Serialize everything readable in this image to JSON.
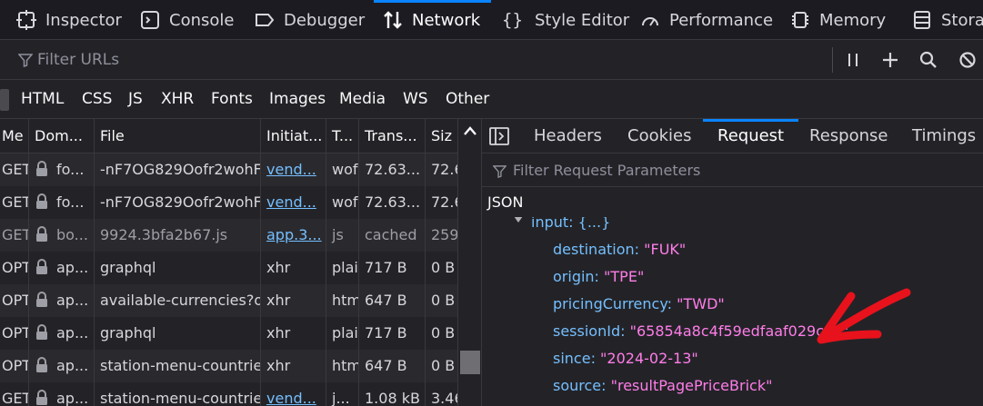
{
  "toolbar": {
    "tabs": [
      {
        "label": "Inspector",
        "icon": "inspector-icon"
      },
      {
        "label": "Console",
        "icon": "console-icon"
      },
      {
        "label": "Debugger",
        "icon": "debugger-icon"
      },
      {
        "label": "Network",
        "icon": "network-icon",
        "active": true
      },
      {
        "label": "Style Editor",
        "icon": "braces-icon"
      },
      {
        "label": "Performance",
        "icon": "gauge-icon"
      },
      {
        "label": "Memory",
        "icon": "chip-icon"
      },
      {
        "label": "Storag",
        "icon": "storage-icon"
      }
    ]
  },
  "filter": {
    "placeholder": "Filter URLs"
  },
  "type_filters": [
    "HTML",
    "CSS",
    "JS",
    "XHR",
    "Fonts",
    "Images",
    "Media",
    "WS",
    "Other"
  ],
  "table": {
    "headers": [
      "Me",
      "Dom...",
      "File",
      "Initiat...",
      "T...",
      "Trans...",
      "Siz"
    ],
    "rows": [
      {
        "method": "GET",
        "domain": "fo...",
        "file": "-nF7OG829Oofr2wohF",
        "initiator": "vend...",
        "type": "wof",
        "transferred": "72.63...",
        "size": "72.6"
      },
      {
        "method": "GET",
        "domain": "fo...",
        "file": "-nF7OG829Oofr2wohF",
        "initiator": "vend...",
        "type": "wof",
        "transferred": "72.63...",
        "size": "72.6"
      },
      {
        "method": "GET",
        "domain": "bo...",
        "file": "9924.3bfa2b67.js",
        "initiator": "app.3...",
        "type": "js",
        "transferred": "cached",
        "size": "259"
      },
      {
        "method": "OPT",
        "domain": "ap...",
        "file": "graphql",
        "initiator": "xhr",
        "type": "plai",
        "transferred": "717 B",
        "size": "0 B"
      },
      {
        "method": "OPT",
        "domain": "ap...",
        "file": "available-currencies?o",
        "initiator": "xhr",
        "type": "htm",
        "transferred": "647 B",
        "size": "0 B"
      },
      {
        "method": "OPT",
        "domain": "ap...",
        "file": "graphql",
        "initiator": "xhr",
        "type": "plai",
        "transferred": "717 B",
        "size": "0 B"
      },
      {
        "method": "OPT",
        "domain": "ap...",
        "file": "station-menu-countrie",
        "initiator": "xhr",
        "type": "htm",
        "transferred": "647 B",
        "size": "0 B"
      },
      {
        "method": "GET",
        "domain": "ap...",
        "file": "station-menu-countrie",
        "initiator": "vend...",
        "type": "j...",
        "transferred": "1.08 kB",
        "size": "3.46"
      }
    ]
  },
  "details": {
    "tabs": [
      "Headers",
      "Cookies",
      "Request",
      "Response",
      "Timings"
    ],
    "active_tab": "Request",
    "filter_placeholder": "Filter Request Parameters",
    "section": "JSON",
    "tree_parent": "input: {...}",
    "params": [
      {
        "key": "destination:",
        "value": "\"FUK\""
      },
      {
        "key": "origin:",
        "value": "\"TPE\""
      },
      {
        "key": "pricingCurrency:",
        "value": "\"TWD\""
      },
      {
        "key": "sessionId:",
        "value": "\"65854a8c4f59edfaaf029c8a\""
      },
      {
        "key": "since:",
        "value": "\"2024-02-13\""
      },
      {
        "key": "source:",
        "value": "\"resultPagePriceBrick\""
      }
    ]
  },
  "annotation": {
    "color": "#e8121c"
  }
}
